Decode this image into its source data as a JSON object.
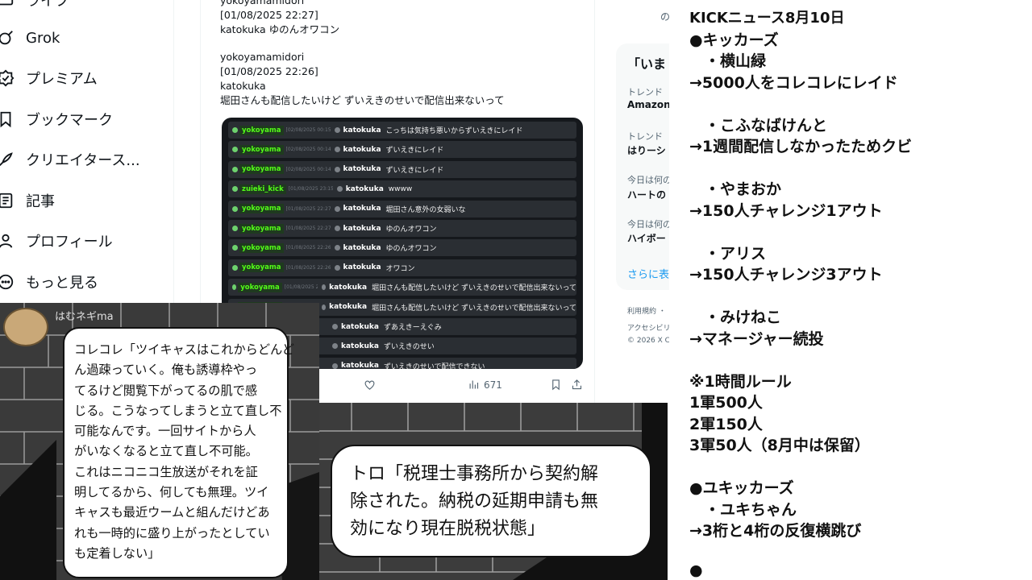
{
  "sidebar": {
    "items": [
      {
        "label": "ライブ",
        "icon": "live-icon"
      },
      {
        "label": "Grok",
        "icon": "grok-icon"
      },
      {
        "label": "プレミアム",
        "icon": "premium-icon"
      },
      {
        "label": "ブックマーク",
        "icon": "bookmark-icon"
      },
      {
        "label": "クリエイタース...",
        "icon": "creator-icon"
      },
      {
        "label": "記事",
        "icon": "article-icon"
      },
      {
        "label": "プロフィール",
        "icon": "profile-icon"
      },
      {
        "label": "もっと見る",
        "icon": "more-icon"
      }
    ]
  },
  "tweet": {
    "messages": [
      {
        "user": "yokoyamamidori",
        "time": "[01/08/2025 22:27]",
        "name": "katokuka",
        "text": "katokuka ゆのんオワコン"
      },
      {
        "user": "yokoyamamidori",
        "time": "[01/08/2025 22:26]",
        "name": "katokuka",
        "text": "堀田さんも配信したいけど ずいえきのせいで配信出来ないって"
      }
    ],
    "chat_rows": [
      {
        "u1": "yokoyama",
        "ts": "[02/08/2025 00:15]",
        "u2": "katokuka",
        "text": "こっちは気持ち悪いからずいえきにレイド"
      },
      {
        "u1": "yokoyama",
        "ts": "[02/08/2025 00:14]",
        "u2": "katokuka",
        "text": "ずいえきにレイド"
      },
      {
        "u1": "yokoyama",
        "ts": "[02/08/2025 00:14]",
        "u2": "katokuka",
        "text": "ずいえきにレイド"
      },
      {
        "u1": "zuieki_kick",
        "ts": "[01/08/2025 23:15]",
        "u2": "katokuka",
        "text": "wwww"
      },
      {
        "u1": "yokoyama",
        "ts": "[01/08/2025 22:27]",
        "u2": "katokuka",
        "text": "堀田さん意外の女弱いな"
      },
      {
        "u1": "yokoyama",
        "ts": "[01/08/2025 22:27]",
        "u2": "katokuka",
        "text": "ゆのんオワコン"
      },
      {
        "u1": "yokoyama",
        "ts": "[01/08/2025 22:26]",
        "u2": "katokuka",
        "text": "ゆのんオワコン"
      },
      {
        "u1": "yokoyama",
        "ts": "[01/08/2025 22:26]",
        "u2": "katokuka",
        "text": "オワコン"
      },
      {
        "u1": "yokoyama",
        "ts": "[01/08/2025 22:26]",
        "u2": "katokuka",
        "text": "堀田さんも配信したいけど ずいえきのせいで配信出来ないって"
      },
      {
        "u1": "yokoyama",
        "ts": "[01/08/2025 22:26]",
        "u2": "katokuka",
        "text": "堀田さんも配信したいけど ずいえきのせいで配信出来ないって"
      },
      {
        "u1": "",
        "ts": "",
        "u2": "katokuka",
        "text": "ずあえきーえぐみ"
      },
      {
        "u1": "",
        "ts": "",
        "u2": "katokuka",
        "text": "ずいえきのせい"
      },
      {
        "u1": "",
        "ts": "",
        "u2": "katokuka",
        "text": "ずいえきのせいで配信できない"
      }
    ],
    "views": "671"
  },
  "trends": {
    "header": "「いま",
    "top_partial": "の",
    "items": [
      {
        "meta": "トレンド",
        "title": "Amazon"
      },
      {
        "meta": "トレンド",
        "title": "はりーシ"
      },
      {
        "meta": "今日は何の",
        "title": "ハートの"
      },
      {
        "meta": "今日は何の",
        "title": "ハイボー"
      }
    ],
    "show_more": "さらに表",
    "footer": [
      "利用規約 ・",
      "アクセシビリ",
      "© 2026 X Co"
    ]
  },
  "panels": {
    "left": {
      "speaker": "はむネギma",
      "bubble_lines": [
        "コレコレ「ツイキャスはこれからどんど",
        "ん過疎っていく。俺も誘導枠やっ",
        "てるけど閲覧下がってるの肌で感",
        "じる。こうなってしまうと立て直し不",
        "可能なんです。一回サイトから人",
        "がいなくなると立て直し不可能。",
        "これはニコニコ生放送がそれを証",
        "明してるから、何しても無理。ツイ",
        "キャスも最近ウームと組んだけどあ",
        "れも一時的に盛り上がったとしてい",
        "も定着しない」"
      ]
    },
    "mid": {
      "bubble_lines": [
        "トロ「税理士事務所から契約解",
        "除された。納税の延期申請も無",
        "効になり現在脱税状態」"
      ]
    }
  },
  "news": {
    "lines": [
      "KICKニュース8月10日",
      "●キッカーズ",
      "　・横山緑",
      "→5000人をコレコレにレイド",
      "",
      "　・こふなばけんと",
      "→1週間配信しなかったためクビ",
      "",
      "　・やまおか",
      "→150人チャレンジ1アウト",
      "",
      "　・アリス",
      "→150人チャレンジ3アウト",
      "",
      "　・みけねこ",
      "→マネージャー続投",
      "",
      "※1時間ルール",
      "1軍500人",
      "2軍150人",
      "3軍50人（8月中は保留）",
      "",
      "●ユキッカーズ",
      "　・ユキちゃん",
      "→3桁と4桁の反復横跳び",
      "",
      "●"
    ]
  }
}
